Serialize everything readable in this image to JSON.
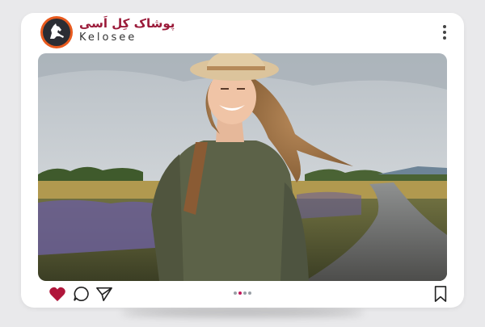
{
  "post": {
    "brand_name_fa": "پوشاک کِل اَسی",
    "brand_name_en": "Kelosee"
  },
  "colors": {
    "brand": "#9b1b3a",
    "avatar_ring": "#e85a1e",
    "like": "#b0163b",
    "carousel_active": "#c2185b"
  },
  "icons": [
    "horse-logo-icon",
    "more-options-icon",
    "heart-icon",
    "comment-icon",
    "share-icon",
    "bookmark-icon"
  ],
  "carousel": {
    "total": 4,
    "active": 2
  }
}
